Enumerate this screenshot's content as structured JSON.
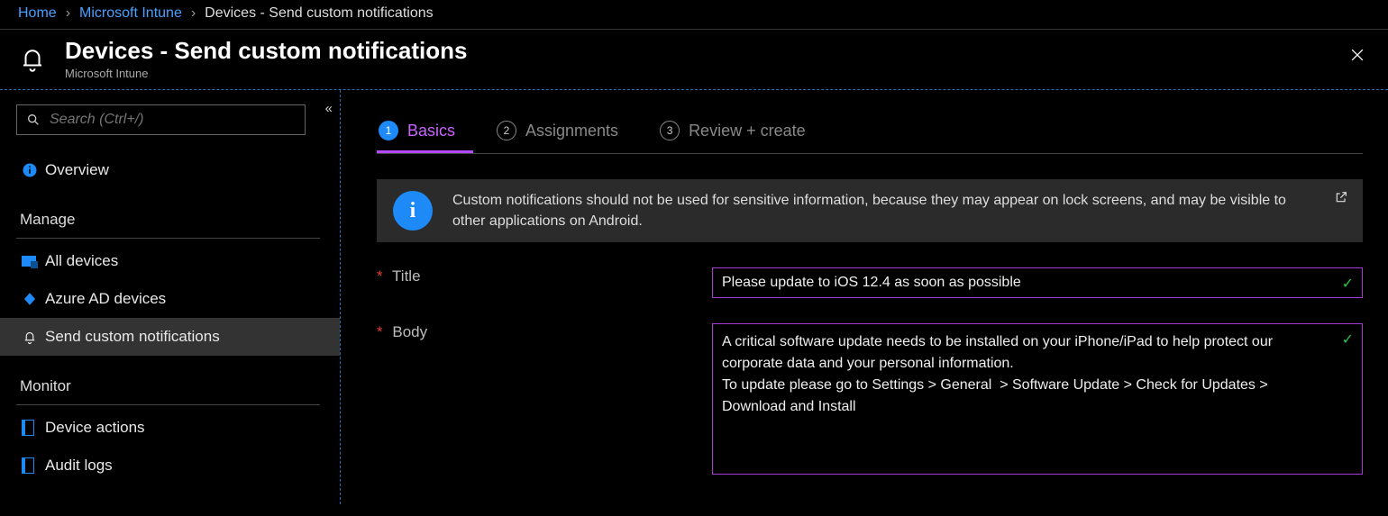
{
  "breadcrumb": {
    "home": "Home",
    "intune": "Microsoft Intune",
    "current": "Devices - Send custom notifications"
  },
  "header": {
    "title": "Devices - Send custom notifications",
    "subtitle": "Microsoft Intune"
  },
  "sidebar": {
    "search_placeholder": "Search (Ctrl+/)",
    "overview": "Overview",
    "section_manage": "Manage",
    "all_devices": "All devices",
    "azure_ad": "Azure AD devices",
    "send_notif": "Send custom notifications",
    "section_monitor": "Monitor",
    "device_actions": "Device actions",
    "audit_logs": "Audit logs"
  },
  "tabs": {
    "basics_num": "1",
    "basics": "Basics",
    "assign_num": "2",
    "assign": "Assignments",
    "review_num": "3",
    "review": "Review + create"
  },
  "info": {
    "text": "Custom notifications should not be used for sensitive information, because they may appear on lock screens, and may be visible to other applications on Android."
  },
  "form": {
    "title_label": "Title",
    "title_value": "Please update to iOS 12.4 as soon as possible",
    "body_label": "Body",
    "body_value": "A critical software update needs to be installed on your iPhone/iPad to help protect our corporate data and your personal information.\nTo update please go to Settings > General  > Software Update > Check for Updates > Download and Install"
  }
}
